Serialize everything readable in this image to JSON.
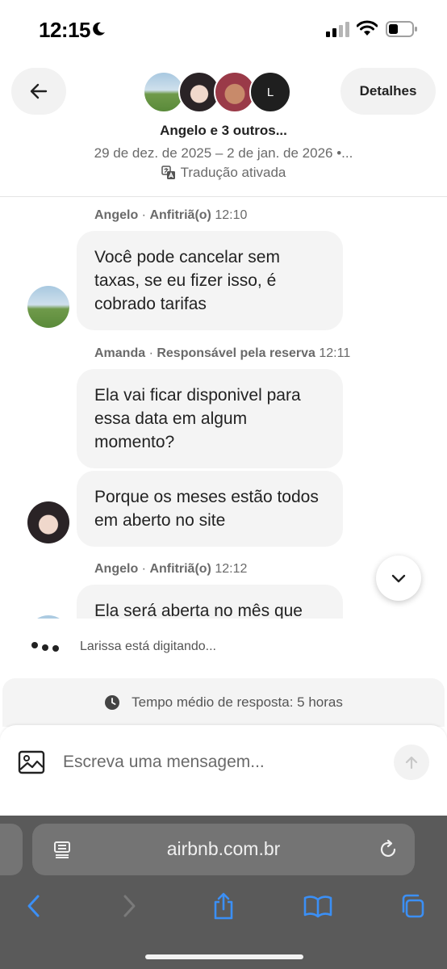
{
  "status_bar": {
    "time": "12:15",
    "icons": [
      "moon-icon",
      "signal-icon",
      "wifi-icon",
      "battery-icon"
    ]
  },
  "header": {
    "back_icon": "arrow-left-icon",
    "details_label": "Detalhes",
    "avatar_initial": "L",
    "title": "Angelo e 3 outros...",
    "dates": "29 de dez. de 2025 – 2 de jan. de 2026 •...",
    "translation_label": "Tradução ativada",
    "translation_icon": "translate-icon"
  },
  "messages": [
    {
      "sender": "Angelo",
      "role": "Anfitriã(o)",
      "time": "12:10",
      "bubbles": [
        "Você pode cancelar sem taxas, se eu fizer isso, é cobrado tarifas"
      ]
    },
    {
      "sender": "Amanda",
      "role": "Responsável pela reserva",
      "time": "12:11",
      "bubbles": [
        "Ela vai ficar disponivel para essa data em algum momento?",
        "Porque os meses estão todos em aberto no site"
      ]
    },
    {
      "sender": "Angelo",
      "role": "Anfitriã(o)",
      "time": "12:12",
      "bubbles": [
        "Ela será aberta no mês que"
      ]
    }
  ],
  "scroll_button_icon": "chevron-down-icon",
  "typing": {
    "text": "Larissa está digitando..."
  },
  "response_time": {
    "text": "Tempo médio de resposta: 5 horas",
    "icon": "clock-icon"
  },
  "composer": {
    "placeholder": "Escreva uma mensagem...",
    "attach_icon": "image-icon",
    "send_icon": "arrow-up-icon"
  },
  "browser": {
    "url": "airbnb.com.br",
    "toolbar_icons": [
      "back-icon",
      "forward-icon",
      "share-icon",
      "bookmarks-icon",
      "tabs-icon"
    ]
  },
  "colors": {
    "text": "#222222",
    "muted": "#6a6a6a",
    "bubble": "#f4f4f4",
    "safari_bar": "#5a5a5a",
    "safari_accent": "#3b8ff5"
  }
}
